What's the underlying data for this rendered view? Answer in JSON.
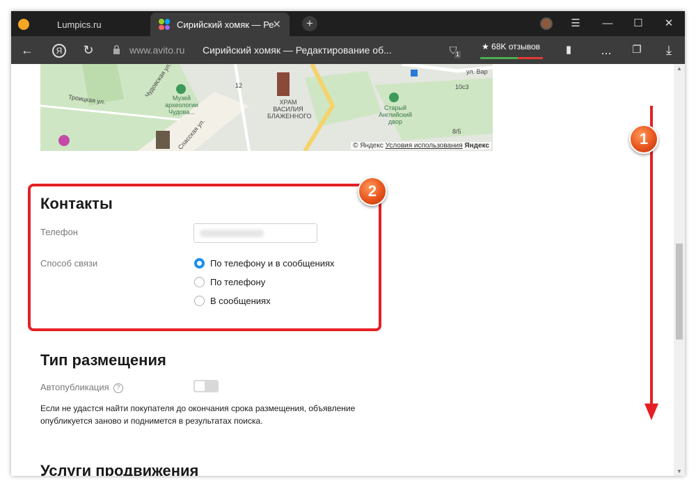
{
  "browser": {
    "tabs": [
      {
        "label": "Lumpics.ru"
      },
      {
        "label": "Сирийский хомяк — Ре"
      }
    ],
    "new_tab_label": "+",
    "address": {
      "domain": "www.avito.ru",
      "title": "Сирийский хомяк — Редактирование об..."
    },
    "reviews_label": "★ 68K отзывов",
    "shield_count": "1",
    "more_label": "...",
    "colors": {
      "titlebar": "#1f1f1f",
      "navbar": "#3c3c3c",
      "accent": "#1d8ef0",
      "highlight": "#e52025"
    }
  },
  "map": {
    "copyright": "© Яндекс",
    "terms": "Условия использования",
    "brand": "Яндекс",
    "labels": {
      "street_troitskaya": "Троицкая ул.",
      "street_chudovskaya": "Чудовская ул.",
      "street_spasskaya": "Спасская ул.",
      "street_var": "ул. Вар",
      "museum": "Музей археологии Чудова...",
      "church": "ХРАМ ВАСИЛИЯ БЛАЖЕННОГО",
      "yard": "Старый Английский двор",
      "num_12": "12",
      "num_10c3": "10с3",
      "num_8_5": "8/5"
    }
  },
  "contacts": {
    "title": "Контакты",
    "phone_label": "Телефон",
    "method_label": "Способ связи",
    "options": [
      {
        "label": "По телефону и в сообщениях",
        "checked": true
      },
      {
        "label": "По телефону",
        "checked": false
      },
      {
        "label": "В сообщениях",
        "checked": false
      }
    ]
  },
  "placement": {
    "title": "Тип размещения",
    "autopublish_label": "Автопубликация",
    "help": "?",
    "autopublish_on": false,
    "description": "Если не удастся найти покупателя до окончания срока размещения, объявление опубликуется заново и поднимется в результатах поиска."
  },
  "promotion": {
    "title": "Услуги продвижения"
  },
  "annotations": {
    "badge_1": "1",
    "badge_2": "2"
  }
}
